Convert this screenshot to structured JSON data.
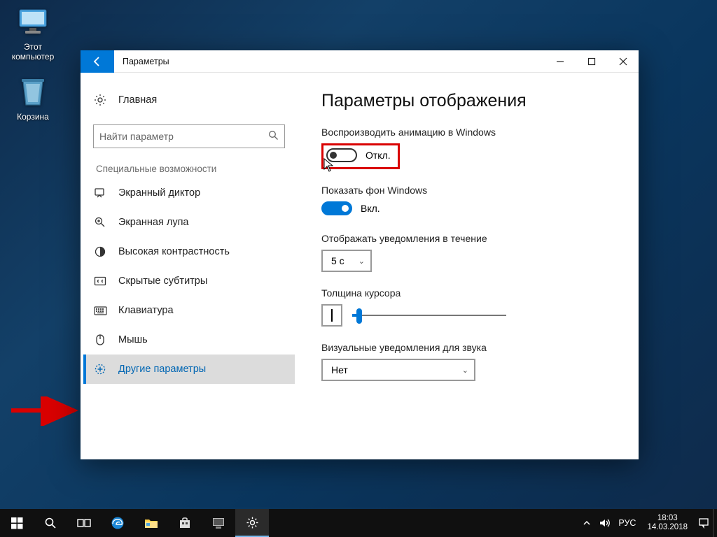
{
  "desktop": {
    "icons": [
      {
        "label": "Этот компьютер"
      },
      {
        "label": "Корзина"
      }
    ]
  },
  "window": {
    "title": "Параметры",
    "sidebar": {
      "home": "Главная",
      "search_placeholder": "Найти параметр",
      "section": "Специальные возможности",
      "items": [
        {
          "label": "Экранный диктор"
        },
        {
          "label": "Экранная лупа"
        },
        {
          "label": "Высокая контрастность"
        },
        {
          "label": "Скрытые субтитры"
        },
        {
          "label": "Клавиатура"
        },
        {
          "label": "Мышь"
        },
        {
          "label": "Другие параметры"
        }
      ]
    },
    "content": {
      "title": "Параметры отображения",
      "anim_label": "Воспроизводить анимацию в Windows",
      "anim_state": "Откл.",
      "bg_label": "Показать фон Windows",
      "bg_state": "Вкл.",
      "notif_label": "Отображать уведомления в течение",
      "notif_value": "5 с",
      "cursor_label": "Толщина курсора",
      "visual_label": "Визуальные уведомления для звука",
      "visual_value": "Нет"
    }
  },
  "taskbar": {
    "lang": "РУС",
    "time": "18:03",
    "date": "14.03.2018"
  }
}
